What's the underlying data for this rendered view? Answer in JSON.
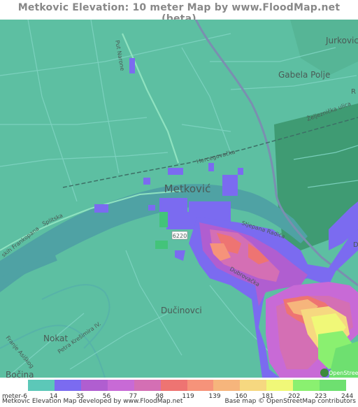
{
  "title": "Metkovic Elevation: 10 meter Map by www.FloodMap.net (beta)",
  "map": {
    "place_labels": {
      "city": "Metković",
      "jurkovic": "Jurkovic",
      "gabela": "Gabela Polje",
      "nokat": "Nokat",
      "ducinovci": "Dučinovci",
      "bocina": "Bočina"
    },
    "road_labels": {
      "put_narone": "Put Narone",
      "hercegovacka": "Hercegovačka",
      "zeljeznicka": "Željeznička ulica",
      "frankopana": "skih Frankopana",
      "splitska": "Splitska",
      "stjepana_radica": "Stjepana Radića",
      "dubrovacka": "Dubrovačka",
      "petra_kresimira": "Petra Krešimira IV.",
      "franje_asiskog": "Franje Asiškog",
      "route_6220": "6220",
      "edge_r": "R",
      "edge_d": "D"
    },
    "osm_badge": "OpenStreetMap"
  },
  "legend": {
    "unit": "meter",
    "ticks": [
      "-6",
      "14",
      "35",
      "56",
      "77",
      "98",
      "119",
      "139",
      "160",
      "181",
      "202",
      "223",
      "244"
    ],
    "colors": [
      "#5cc8b8",
      "#7b6bf0",
      "#b05ed0",
      "#c86ad6",
      "#d46fb4",
      "#ee7472",
      "#f6937a",
      "#f6b57c",
      "#f6d880",
      "#f0f878",
      "#8af070",
      "#6ee070"
    ]
  },
  "footer": {
    "left": "Metkovic Elevation Map developed by www.FloodMap.net",
    "right": "Base map © OpenStreetMap contributors"
  }
}
